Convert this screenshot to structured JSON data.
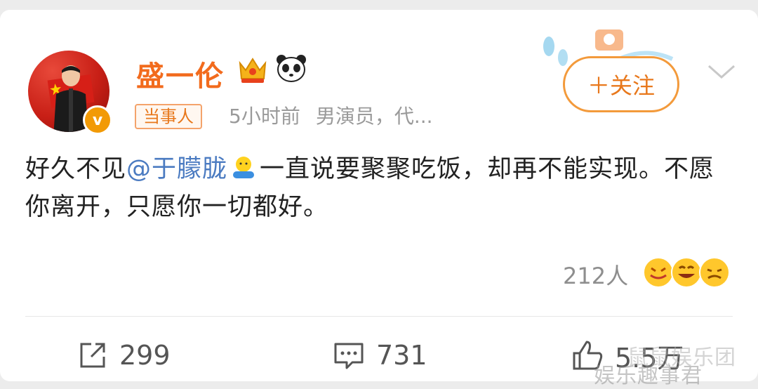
{
  "post": {
    "username": "盛一伦",
    "tag": "当事人",
    "time": "5小时前",
    "description": "男演员，代...",
    "follow_label": "＋关注",
    "content": {
      "prefix": "好久不见",
      "mention": "@于朦胧",
      "suffix": "一直说要聚聚吃饭，却再不能实现。不愿你离开，只愿你一切都好。"
    },
    "reactions_count": "212人"
  },
  "actions": {
    "repost_count": "299",
    "comment_count": "731",
    "like_count": "5.5万"
  },
  "watermarks": {
    "line1": "鼠鼠娱乐团",
    "line2": "娱乐趣事君"
  },
  "colors": {
    "username": "#f26b1d",
    "accent": "#f39a3b",
    "mention": "#4b7bc1",
    "text": "#222222",
    "meta": "#9a9a9a",
    "badge": "#f29a06"
  },
  "icons": [
    "crown-icon",
    "panda-icon",
    "verified-badge",
    "chevron-down-icon",
    "hug-emoji-icon",
    "reaction-emoji-icons",
    "repost-icon",
    "comment-icon",
    "like-icon"
  ]
}
